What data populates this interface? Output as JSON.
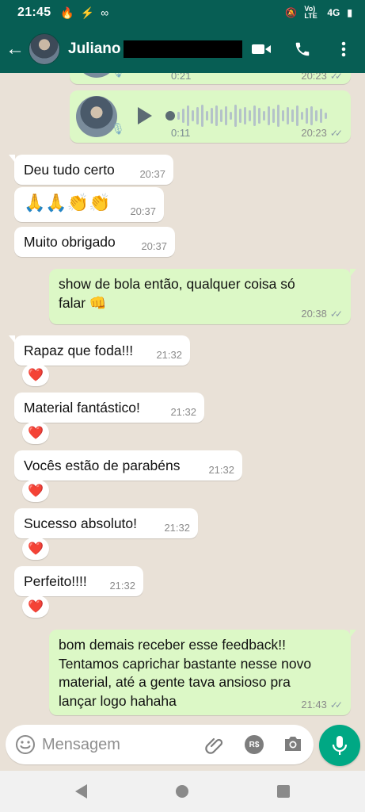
{
  "status_bar": {
    "time": "21:45",
    "network": "4G",
    "signal_label": "Vo) LTE"
  },
  "header": {
    "contact_name": "Juliano S"
  },
  "voice_notes": [
    {
      "duration": "0:21",
      "time": "20:23"
    },
    {
      "duration": "0:11",
      "time": "20:23"
    }
  ],
  "messages": [
    {
      "text": "Deu tudo certo",
      "time": "20:37"
    },
    {
      "text": "🙏🙏👏👏",
      "time": "20:37"
    },
    {
      "text": "Muito obrigado",
      "time": "20:37"
    },
    {
      "text_line1": "show de bola então, qualquer coisa só",
      "text_line2": "falar 👊",
      "time": "20:38"
    },
    {
      "text": "Rapaz que foda!!!",
      "time": "21:32",
      "reaction": "❤️"
    },
    {
      "text": "Material fantástico!",
      "time": "21:32",
      "reaction": "❤️"
    },
    {
      "text": "Vocês estão de parabéns",
      "time": "21:32",
      "reaction": "❤️"
    },
    {
      "text": "Sucesso absoluto!",
      "time": "21:32",
      "reaction": "❤️"
    },
    {
      "text": "Perfeito!!!!",
      "time": "21:32",
      "reaction": "❤️"
    },
    {
      "line1": "bom demais receber esse feedback!!",
      "line2": "Tentamos caprichar bastante nesse novo",
      "line3": "material, até a gente tava ansioso pra",
      "line4": "lançar logo hahaha",
      "time": "21:43"
    }
  ],
  "composer": {
    "placeholder": "Mensagem",
    "pay_label": "R$"
  },
  "colors": {
    "header": "#075e54",
    "outgoing": "#dcf8c6",
    "incoming": "#ffffff",
    "accent": "#00a884",
    "background": "#e9e1d7"
  }
}
